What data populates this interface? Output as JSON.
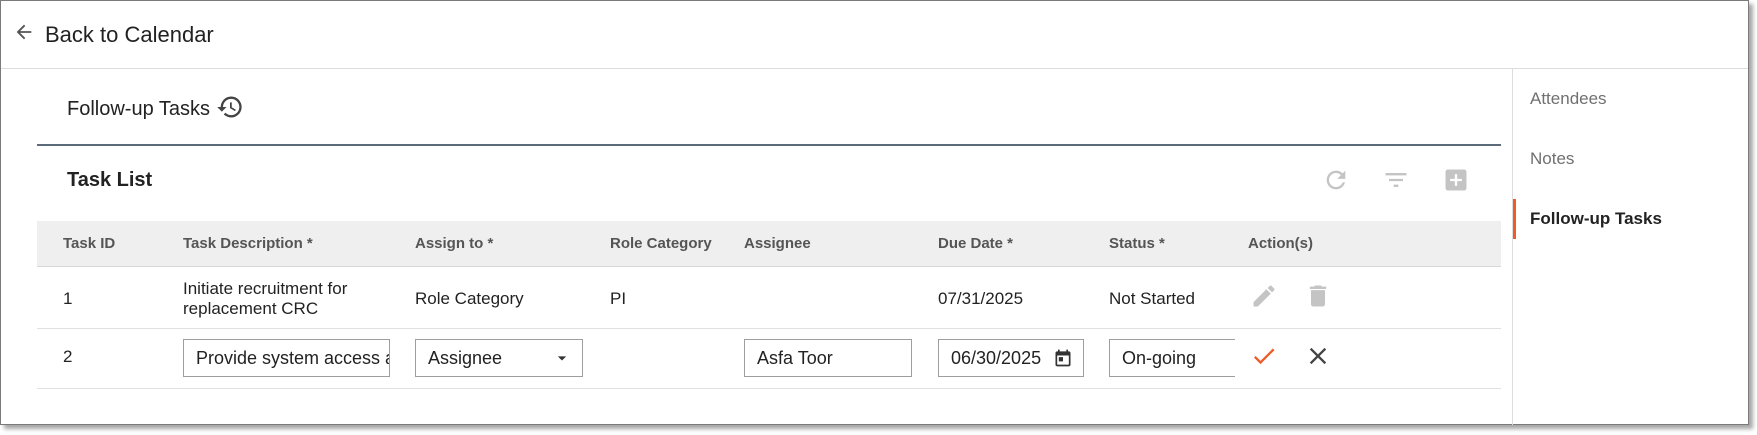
{
  "header": {
    "back_label": "Back to Calendar"
  },
  "section": {
    "title": "Follow-up Tasks"
  },
  "task_list": {
    "title": "Task List",
    "columns": [
      "Task ID",
      "Task Description *",
      "Assign to *",
      "Role Category",
      "Assignee",
      "Due Date *",
      "Status *",
      "Action(s)"
    ],
    "rows": [
      {
        "id": "1",
        "description": "Initiate recruitment for replacement CRC",
        "assign_to": "Role Category",
        "role_category": "PI",
        "assignee": "",
        "due_date": "07/31/2025",
        "status": "Not Started"
      },
      {
        "id": "2",
        "description": "Provide system access ar",
        "assign_to": "Assignee",
        "role_category": "",
        "assignee": "Asfa Toor",
        "due_date": "06/30/2025",
        "status": "On-going"
      }
    ]
  },
  "sidebar": {
    "items": [
      {
        "label": "Attendees"
      },
      {
        "label": "Notes"
      },
      {
        "label": "Follow-up Tasks"
      }
    ]
  },
  "colors": {
    "accent": "#f05a28",
    "divider": "#5b6b7a",
    "icon_muted": "#c4c4c4",
    "header_bg": "#efefef"
  },
  "icons": [
    "arrow-back-icon",
    "history-icon",
    "refresh-icon",
    "filter-icon",
    "add-box-icon",
    "edit-icon",
    "delete-icon",
    "dropdown-arrow-icon",
    "calendar-icon",
    "check-icon",
    "close-icon"
  ]
}
